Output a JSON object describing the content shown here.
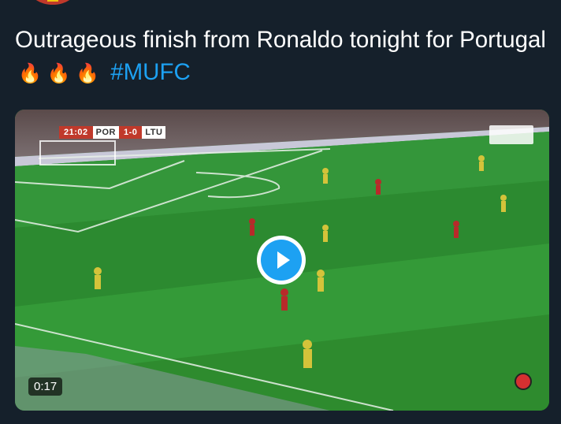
{
  "tweet": {
    "text": "Outrageous finish from Ronaldo tonight for Portugal",
    "emojis": "🔥 🔥 🔥",
    "hashtag": "#MUFC"
  },
  "video": {
    "duration": "0:17",
    "play_icon": "play-icon",
    "scorebug": {
      "time": "21:02",
      "home": "POR",
      "score": "1-0",
      "away": "LTU"
    }
  },
  "colors": {
    "background": "#15202b",
    "text": "#ffffff",
    "link": "#1da1f2",
    "play": "#1da1f2"
  }
}
